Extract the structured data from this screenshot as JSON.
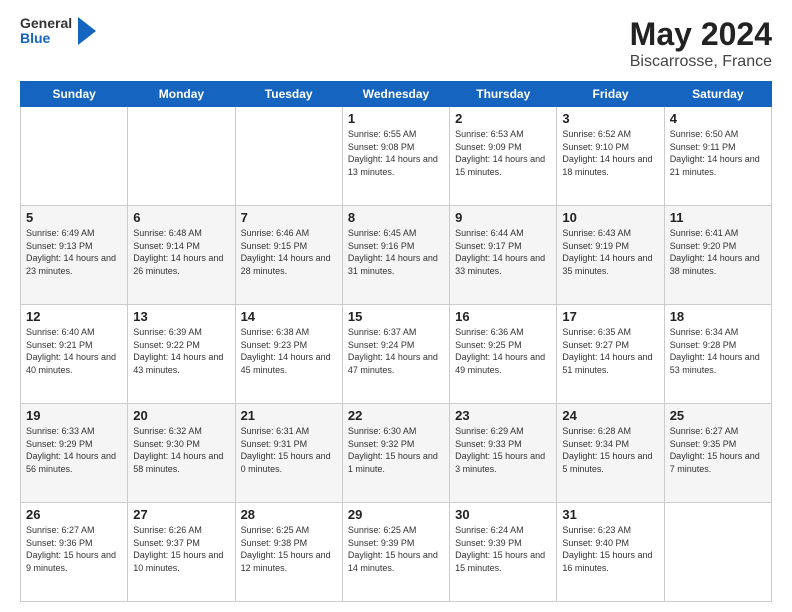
{
  "header": {
    "logo": {
      "line1": "General",
      "line2": "Blue"
    },
    "title": "May 2024",
    "subtitle": "Biscarrosse, France"
  },
  "days_of_week": [
    "Sunday",
    "Monday",
    "Tuesday",
    "Wednesday",
    "Thursday",
    "Friday",
    "Saturday"
  ],
  "weeks": [
    [
      {
        "day": "",
        "info": ""
      },
      {
        "day": "",
        "info": ""
      },
      {
        "day": "",
        "info": ""
      },
      {
        "day": "1",
        "info": "Sunrise: 6:55 AM\nSunset: 9:08 PM\nDaylight: 14 hours and 13 minutes."
      },
      {
        "day": "2",
        "info": "Sunrise: 6:53 AM\nSunset: 9:09 PM\nDaylight: 14 hours and 15 minutes."
      },
      {
        "day": "3",
        "info": "Sunrise: 6:52 AM\nSunset: 9:10 PM\nDaylight: 14 hours and 18 minutes."
      },
      {
        "day": "4",
        "info": "Sunrise: 6:50 AM\nSunset: 9:11 PM\nDaylight: 14 hours and 21 minutes."
      }
    ],
    [
      {
        "day": "5",
        "info": "Sunrise: 6:49 AM\nSunset: 9:13 PM\nDaylight: 14 hours and 23 minutes."
      },
      {
        "day": "6",
        "info": "Sunrise: 6:48 AM\nSunset: 9:14 PM\nDaylight: 14 hours and 26 minutes."
      },
      {
        "day": "7",
        "info": "Sunrise: 6:46 AM\nSunset: 9:15 PM\nDaylight: 14 hours and 28 minutes."
      },
      {
        "day": "8",
        "info": "Sunrise: 6:45 AM\nSunset: 9:16 PM\nDaylight: 14 hours and 31 minutes."
      },
      {
        "day": "9",
        "info": "Sunrise: 6:44 AM\nSunset: 9:17 PM\nDaylight: 14 hours and 33 minutes."
      },
      {
        "day": "10",
        "info": "Sunrise: 6:43 AM\nSunset: 9:19 PM\nDaylight: 14 hours and 35 minutes."
      },
      {
        "day": "11",
        "info": "Sunrise: 6:41 AM\nSunset: 9:20 PM\nDaylight: 14 hours and 38 minutes."
      }
    ],
    [
      {
        "day": "12",
        "info": "Sunrise: 6:40 AM\nSunset: 9:21 PM\nDaylight: 14 hours and 40 minutes."
      },
      {
        "day": "13",
        "info": "Sunrise: 6:39 AM\nSunset: 9:22 PM\nDaylight: 14 hours and 43 minutes."
      },
      {
        "day": "14",
        "info": "Sunrise: 6:38 AM\nSunset: 9:23 PM\nDaylight: 14 hours and 45 minutes."
      },
      {
        "day": "15",
        "info": "Sunrise: 6:37 AM\nSunset: 9:24 PM\nDaylight: 14 hours and 47 minutes."
      },
      {
        "day": "16",
        "info": "Sunrise: 6:36 AM\nSunset: 9:25 PM\nDaylight: 14 hours and 49 minutes."
      },
      {
        "day": "17",
        "info": "Sunrise: 6:35 AM\nSunset: 9:27 PM\nDaylight: 14 hours and 51 minutes."
      },
      {
        "day": "18",
        "info": "Sunrise: 6:34 AM\nSunset: 9:28 PM\nDaylight: 14 hours and 53 minutes."
      }
    ],
    [
      {
        "day": "19",
        "info": "Sunrise: 6:33 AM\nSunset: 9:29 PM\nDaylight: 14 hours and 56 minutes."
      },
      {
        "day": "20",
        "info": "Sunrise: 6:32 AM\nSunset: 9:30 PM\nDaylight: 14 hours and 58 minutes."
      },
      {
        "day": "21",
        "info": "Sunrise: 6:31 AM\nSunset: 9:31 PM\nDaylight: 15 hours and 0 minutes."
      },
      {
        "day": "22",
        "info": "Sunrise: 6:30 AM\nSunset: 9:32 PM\nDaylight: 15 hours and 1 minute."
      },
      {
        "day": "23",
        "info": "Sunrise: 6:29 AM\nSunset: 9:33 PM\nDaylight: 15 hours and 3 minutes."
      },
      {
        "day": "24",
        "info": "Sunrise: 6:28 AM\nSunset: 9:34 PM\nDaylight: 15 hours and 5 minutes."
      },
      {
        "day": "25",
        "info": "Sunrise: 6:27 AM\nSunset: 9:35 PM\nDaylight: 15 hours and 7 minutes."
      }
    ],
    [
      {
        "day": "26",
        "info": "Sunrise: 6:27 AM\nSunset: 9:36 PM\nDaylight: 15 hours and 9 minutes."
      },
      {
        "day": "27",
        "info": "Sunrise: 6:26 AM\nSunset: 9:37 PM\nDaylight: 15 hours and 10 minutes."
      },
      {
        "day": "28",
        "info": "Sunrise: 6:25 AM\nSunset: 9:38 PM\nDaylight: 15 hours and 12 minutes."
      },
      {
        "day": "29",
        "info": "Sunrise: 6:25 AM\nSunset: 9:39 PM\nDaylight: 15 hours and 14 minutes."
      },
      {
        "day": "30",
        "info": "Sunrise: 6:24 AM\nSunset: 9:39 PM\nDaylight: 15 hours and 15 minutes."
      },
      {
        "day": "31",
        "info": "Sunrise: 6:23 AM\nSunset: 9:40 PM\nDaylight: 15 hours and 16 minutes."
      },
      {
        "day": "",
        "info": ""
      }
    ]
  ]
}
